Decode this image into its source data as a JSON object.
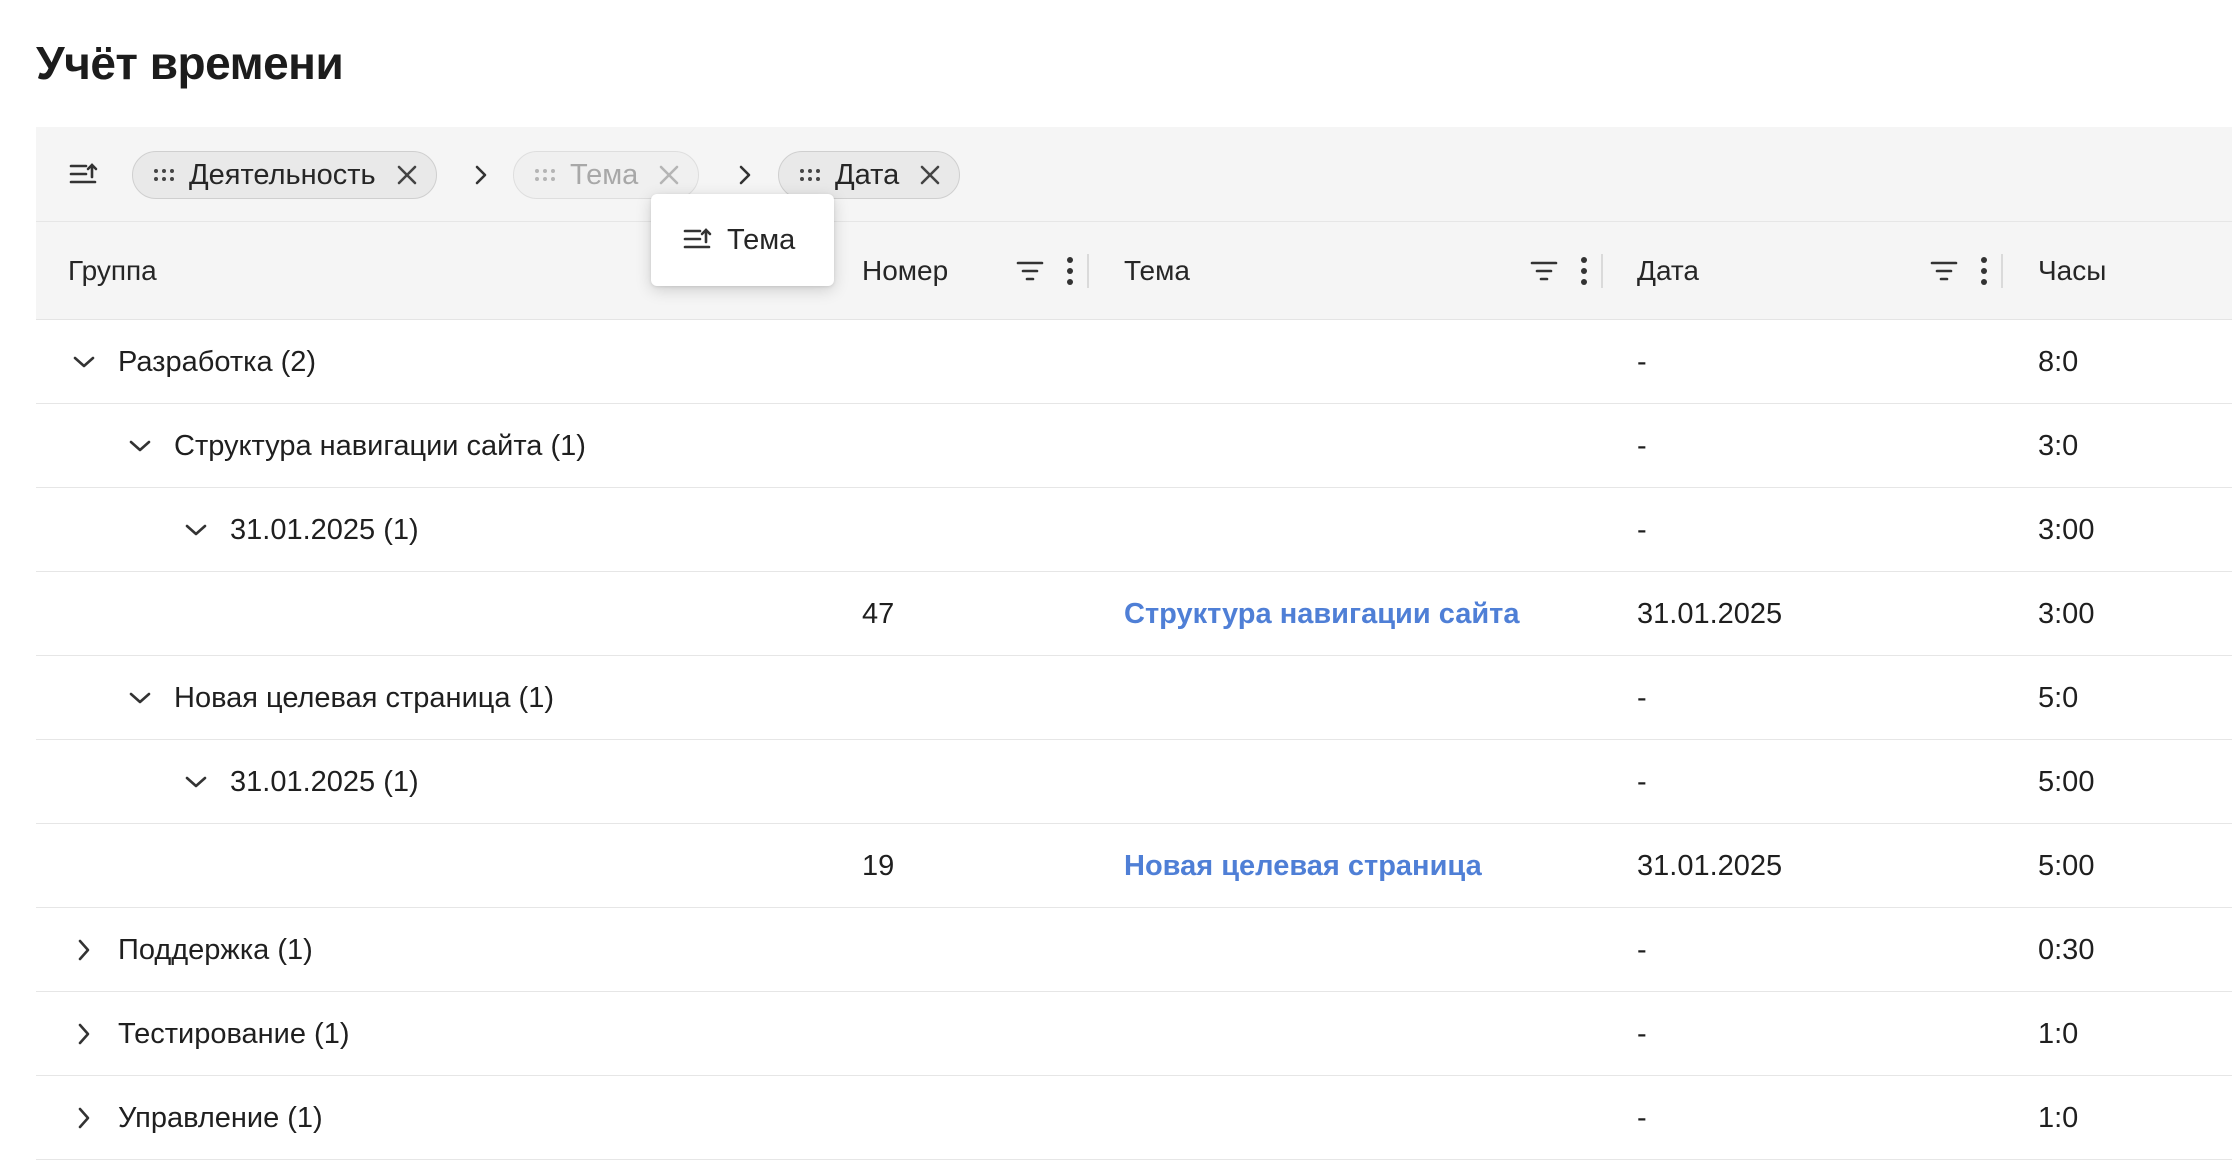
{
  "page": {
    "title": "Учёт времени"
  },
  "grouping": {
    "chips": [
      {
        "label": "Деятельность",
        "state": "normal"
      },
      {
        "label": "Тема",
        "state": "dragging"
      },
      {
        "label": "Дата",
        "state": "normal"
      }
    ],
    "drag_preview_label": "Тема"
  },
  "columns": {
    "group": "Группа",
    "number": "Номер",
    "topic": "Тема",
    "date": "Дата",
    "hours": "Часы"
  },
  "rows": [
    {
      "type": "group",
      "level": 0,
      "expanded": true,
      "label": "Разработка (2)",
      "date": "-",
      "hours": "8:0"
    },
    {
      "type": "group",
      "level": 1,
      "expanded": true,
      "label": "Структура навигации сайта (1)",
      "date": "-",
      "hours": "3:0"
    },
    {
      "type": "group",
      "level": 2,
      "expanded": true,
      "label": "31.01.2025 (1)",
      "date": "-",
      "hours": "3:00"
    },
    {
      "type": "data",
      "number": "47",
      "topic": "Структура навигации сайта",
      "date": "31.01.2025",
      "hours": "3:00"
    },
    {
      "type": "group",
      "level": 1,
      "expanded": true,
      "label": "Новая целевая страница (1)",
      "date": "-",
      "hours": "5:0"
    },
    {
      "type": "group",
      "level": 2,
      "expanded": true,
      "label": "31.01.2025 (1)",
      "date": "-",
      "hours": "5:00"
    },
    {
      "type": "data",
      "number": "19",
      "topic": "Новая целевая страница",
      "date": "31.01.2025",
      "hours": "5:00"
    },
    {
      "type": "group",
      "level": 0,
      "expanded": false,
      "label": "Поддержка (1)",
      "date": "-",
      "hours": "0:30"
    },
    {
      "type": "group",
      "level": 0,
      "expanded": false,
      "label": "Тестирование (1)",
      "date": "-",
      "hours": "1:0"
    },
    {
      "type": "group",
      "level": 0,
      "expanded": false,
      "label": "Управление (1)",
      "date": "-",
      "hours": "1:0"
    }
  ],
  "colors": {
    "link": "#4f7fd6",
    "panel": "#f5f5f5",
    "chip_bg": "#e9e9e9"
  },
  "icons": {
    "group_toggle": "group-by-icon",
    "chip_handle": "drag-grip-icon",
    "chip_remove": "close-icon",
    "separator": "chevron-right-icon",
    "column_filter": "filter-icon",
    "column_menu": "more-vertical-icon",
    "expanded": "chevron-down-icon",
    "collapsed": "chevron-right-icon"
  }
}
